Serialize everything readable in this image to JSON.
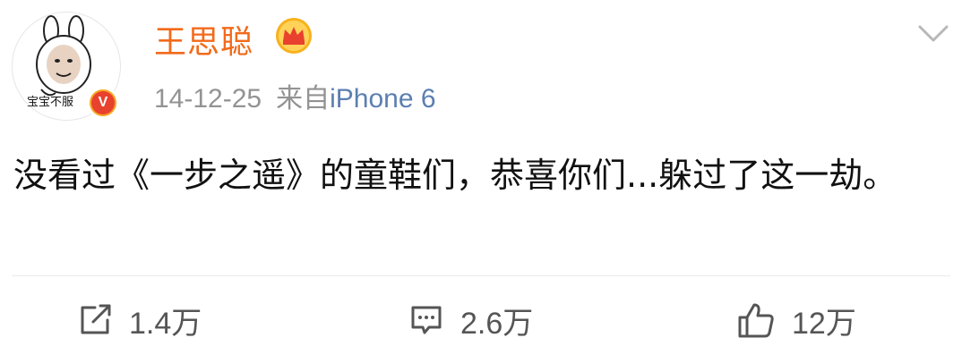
{
  "post": {
    "author": "王思聪",
    "avatar_caption": "宝宝不服",
    "verified_badge": "V",
    "date": "14-12-25",
    "source_prefix": "来自",
    "source_device": "iPhone 6",
    "text": "没看过《一步之遥》的童鞋们，恭喜你们...躲过了这一劫。"
  },
  "icons": {
    "avatar": "meme-avatar",
    "verified": "verified-badge-icon",
    "vip": "crown-icon",
    "menu": "chevron-down-icon",
    "repost": "repost-icon",
    "comment": "comment-icon",
    "like": "thumbs-up-icon"
  },
  "actions": {
    "repost_count": "1.4万",
    "comment_count": "2.6万",
    "like_count": "12万"
  },
  "colors": {
    "author": "#f26a1b",
    "meta": "#939393",
    "source_device": "#5b7fb0",
    "text": "#111111",
    "action_text": "#555555"
  }
}
